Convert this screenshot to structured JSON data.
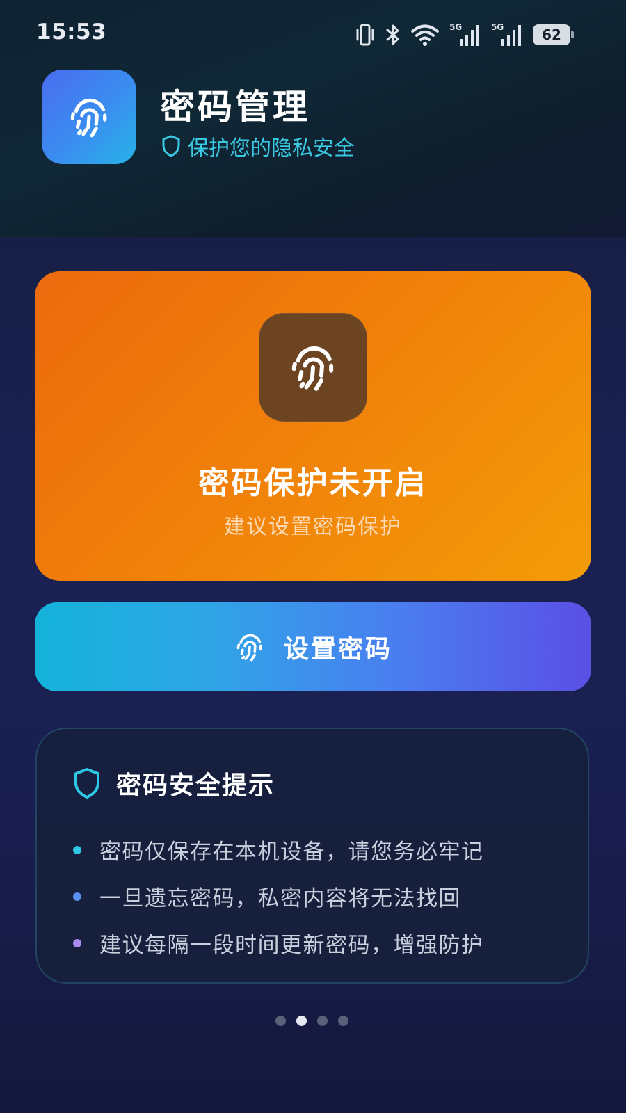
{
  "status_bar": {
    "time": "15:53",
    "network_1": "5G",
    "network_2": "5G",
    "battery": "62",
    "icons": [
      "vibrate-icon",
      "bluetooth-icon",
      "wifi-icon",
      "signal-icon",
      "signal-icon",
      "battery-icon"
    ]
  },
  "header": {
    "title": "密码管理",
    "subtitle": "保护您的隐私安全",
    "logo_icon": "fingerprint-icon",
    "subtitle_icon": "shield-icon"
  },
  "status_card": {
    "icon": "fingerprint-icon",
    "title": "密码保护未开启",
    "subtitle": "建议设置密码保护",
    "colors": {
      "from": "#ec6a0e",
      "to": "#f49c08"
    }
  },
  "set_password_button": {
    "icon": "fingerprint-icon",
    "label": "设置密码"
  },
  "tips": {
    "icon": "shield-icon",
    "title": "密码安全提示",
    "items": [
      {
        "text": "密码仅保存在本机设备，请您务必牢记",
        "dot_color": "#2ec7e6"
      },
      {
        "text": "一旦遗忘密码，私密内容将无法找回",
        "dot_color": "#5b8ff0"
      },
      {
        "text": "建议每隔一段时间更新密码，增强防护",
        "dot_color": "#a98af0"
      }
    ]
  },
  "pagination": {
    "count": 4,
    "active_index": 1
  }
}
